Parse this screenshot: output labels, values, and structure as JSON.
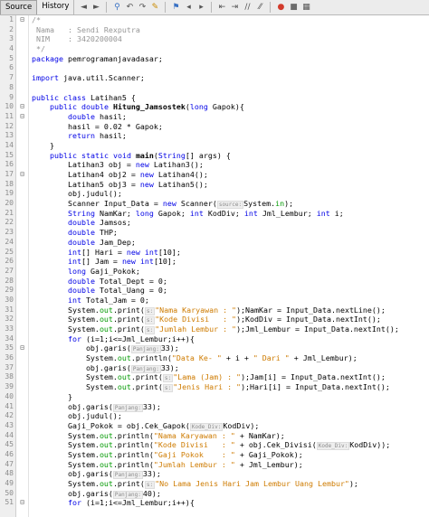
{
  "toolbar": {
    "tab_source": "Source",
    "tab_history": "History",
    "buttons": [
      "back-icon",
      "forward-icon",
      "search-icon",
      "find-prev-icon",
      "find-next-icon",
      "highlight-icon",
      "toggle-bookmark-icon",
      "prev-bookmark-icon",
      "next-bookmark-icon",
      "shift-left-icon",
      "shift-right-icon",
      "comment-icon",
      "uncomment-icon",
      "macro-record-icon",
      "macro-stop-icon",
      "grid-icon"
    ]
  },
  "editor": {
    "line_numbers": [
      "1",
      "2",
      "3",
      "4",
      "5",
      "6",
      "7",
      "8",
      "9",
      "10",
      "11",
      "12",
      "13",
      "14",
      "15",
      "16",
      "17",
      "18",
      "19",
      "20",
      "21",
      "22",
      "23",
      "24",
      "25",
      "26",
      "27",
      "28",
      "29",
      "30",
      "31",
      "32",
      "33",
      "34",
      "35",
      "36",
      "37",
      "38",
      "39",
      "40",
      "41",
      "42",
      "43",
      "44",
      "45",
      "46",
      "47",
      "48",
      "49",
      "50",
      "51"
    ],
    "fold_markers": [
      "⊟",
      "",
      "",
      "",
      "",
      "",
      "",
      "",
      "",
      "⊟",
      "⊟",
      "",
      "",
      "",
      "",
      "",
      "⊟",
      "",
      "",
      "",
      "",
      "",
      "",
      "",
      "",
      "",
      "",
      "",
      "",
      "",
      "",
      "",
      "",
      "",
      "⊟",
      "",
      "",
      "",
      "",
      "",
      "",
      "",
      "",
      "",
      "",
      "",
      "",
      "",
      "",
      "",
      "⊟"
    ],
    "lines": [
      "/*",
      " Nama   : Sendi Rexputra",
      " NIM    : 3420200004",
      " */",
      "package pemrogramanjavadasar;",
      "",
      "import java.util.Scanner;",
      "",
      "public class Latihan5 {",
      "    public double Hitung_Jamsostek(long Gapok){",
      "        double hasil;",
      "        hasil = 0.02 * Gapok;",
      "        return hasil;",
      "    }",
      "    public static void main(String[] args) {",
      "        Latihan3 obj = new Latihan3();",
      "        Latihan4 obj2 = new Latihan4();",
      "        Latihan5 obj3 = new Latihan5();",
      "        obj.judul();",
      "        Scanner Input_Data = new Scanner(source:System.in);",
      "        String NamKar; long Gapok; int KodDiv; int Jml_Lembur; int i;",
      "        double Jamsos;",
      "        double THP;",
      "        double Jam_Dep;",
      "        int[] Hari = new int[10];",
      "        int[] Jam = new int[10];",
      "        long Gaji_Pokok;",
      "        double Total_Dept = 0;",
      "        double Total_Uang = 0;",
      "        int Total_Jam = 0;",
      "        System.out.print(s:\"Nama Karyawan : \");NamKar = Input_Data.nextLine();",
      "        System.out.print(s:\"Kode Divisi   : \");KodDiv = Input_Data.nextInt();",
      "        System.out.print(s:\"Jumlah Lembur : \");Jml_Lembur = Input_Data.nextInt();",
      "        for (i=1;i<=Jml_Lembur;i++){",
      "            obj.garis(Panjang:33);",
      "            System.out.println(\"Data Ke- \" + i + \" Dari \" + Jml_Lembur);",
      "            obj.garis(Panjang:33);",
      "            System.out.print(s:\"Lama (Jam) : \");Jam[i] = Input_Data.nextInt();",
      "            System.out.print(s:\"Jenis Hari : \");Hari[i] = Input_Data.nextInt();",
      "        }",
      "        obj.garis(Panjang:33);",
      "        obj.judul();",
      "        Gaji_Pokok = obj.Cek_Gapok(Kode_Div:KodDiv);",
      "        System.out.println(\"Nama Karyawan : \" + NamKar);",
      "        System.out.println(\"Kode Divisi   : \" + obj.Cek_Divisi(Kode_Div:KodDiv));",
      "        System.out.println(\"Gaji Pokok    : \" + Gaji_Pokok);",
      "        System.out.println(\"Jumlah Lembur : \" + Jml_Lembur);",
      "        obj.garis(Panjang:33);",
      "        System.out.print(s:\"No Lama Jenis Hari Jam Lembur Uang Lembur\");",
      "        obj.garis(Panjang:40);",
      "        for (i=1;i<=Jml_Lembur;i++){"
    ]
  },
  "colors": {
    "keyword": "#0000e6",
    "comment": "#969696",
    "string": "#ce7b00",
    "field": "#009900",
    "gutter_bg": "#efefef",
    "toolbar_bg": "#ececec"
  }
}
